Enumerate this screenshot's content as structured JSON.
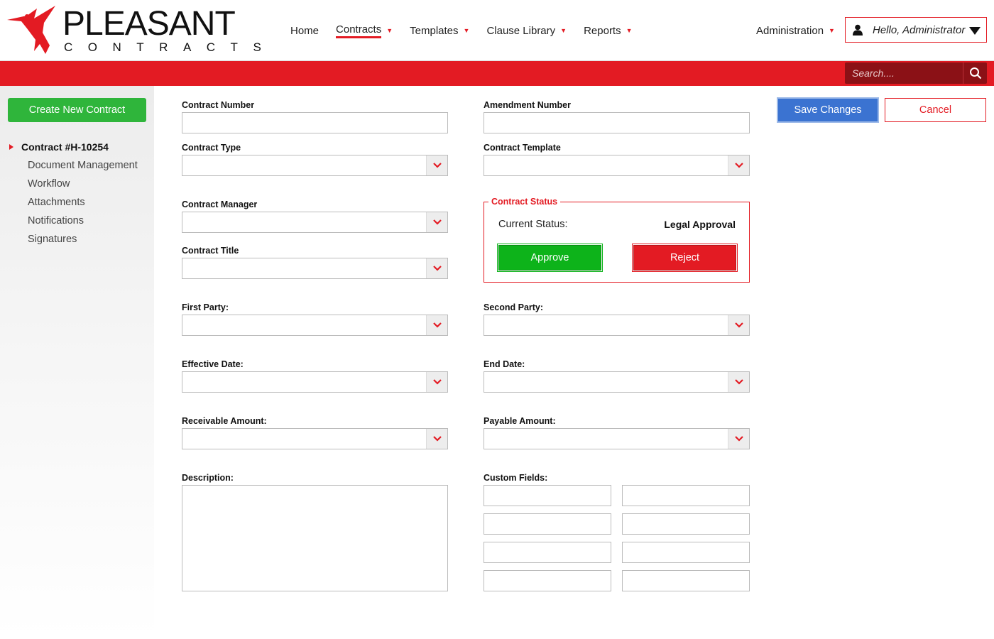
{
  "brand": {
    "name": "PLEASANT",
    "subtitle": "CONTRACTS",
    "accent_color": "#e31b23"
  },
  "nav": {
    "items": [
      {
        "label": "Home",
        "has_caret": false
      },
      {
        "label": "Contracts",
        "has_caret": true,
        "active": true
      },
      {
        "label": "Templates",
        "has_caret": true
      },
      {
        "label": "Clause Library",
        "has_caret": true
      },
      {
        "label": "Reports",
        "has_caret": true
      }
    ],
    "caret": "▼",
    "admin_label": "Administration",
    "user_greeting": "Hello, Administrator"
  },
  "search": {
    "placeholder": "Search...."
  },
  "sidebar": {
    "create_label": "Create New Contract",
    "current_contract": "Contract #H-10254",
    "items": [
      {
        "label": "Document Management"
      },
      {
        "label": "Workflow"
      },
      {
        "label": "Attachments"
      },
      {
        "label": "Notifications"
      },
      {
        "label": "Signatures"
      }
    ]
  },
  "actions": {
    "save_label": "Save Changes",
    "cancel_label": "Cancel"
  },
  "form": {
    "contract_number_label": "Contract Number",
    "contract_number_value": "",
    "amendment_number_label": "Amendment Number",
    "amendment_number_value": "",
    "contract_type_label": "Contract Type",
    "contract_template_label": "Contract Template",
    "contract_manager_label": "Contract Manager",
    "contract_title_label": "Contract Title",
    "first_party_label": "First Party:",
    "second_party_label": "Second Party:",
    "effective_date_label": "Effective Date:",
    "end_date_label": "End Date:",
    "receivable_amount_label": "Receivable Amount:",
    "payable_amount_label": "Payable Amount:",
    "description_label": "Description:",
    "custom_fields_label": "Custom Fields:"
  },
  "status": {
    "legend": "Contract Status",
    "current_label": "Current Status:",
    "current_value": "Legal Approval",
    "approve_label": "Approve",
    "reject_label": "Reject",
    "approve_color": "#0db31a",
    "reject_color": "#e31b23"
  },
  "icons": {
    "logo": "hummingbird-icon",
    "user": "user-icon",
    "search": "search-icon",
    "dropdown": "chevron-down-icon"
  }
}
